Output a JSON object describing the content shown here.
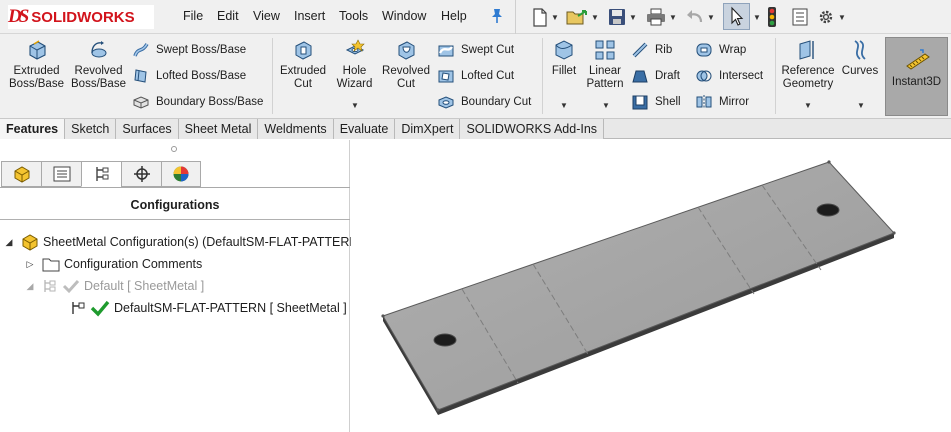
{
  "app": {
    "brand": "SOLIDWORKS",
    "brand_mark": "DS"
  },
  "menu": [
    "File",
    "Edit",
    "View",
    "Insert",
    "Tools",
    "Window",
    "Help"
  ],
  "ribbon": {
    "extruded_boss": "Extruded\nBoss/Base",
    "revolved_boss": "Revolved\nBoss/Base",
    "swept_boss": "Swept Boss/Base",
    "lofted_boss": "Lofted Boss/Base",
    "boundary_boss": "Boundary Boss/Base",
    "extruded_cut": "Extruded\nCut",
    "hole_wizard": "Hole\nWizard",
    "revolved_cut": "Revolved\nCut",
    "swept_cut": "Swept Cut",
    "lofted_cut": "Lofted Cut",
    "boundary_cut": "Boundary Cut",
    "fillet": "Fillet",
    "linear_pattern": "Linear\nPattern",
    "rib": "Rib",
    "draft": "Draft",
    "shell": "Shell",
    "wrap": "Wrap",
    "intersect": "Intersect",
    "mirror": "Mirror",
    "reference_geometry": "Reference\nGeometry",
    "curves": "Curves",
    "instant3d": "Instant3D"
  },
  "tabs": [
    "Features",
    "Sketch",
    "Surfaces",
    "Sheet Metal",
    "Weldments",
    "Evaluate",
    "DimXpert",
    "SOLIDWORKS Add-Ins"
  ],
  "panel": {
    "title": "Configurations",
    "tree": {
      "root": "SheetMetal Configuration(s)  (DefaultSM-FLAT-PATTERN",
      "comments": "Configuration Comments",
      "default": "Default [ SheetMetal ]",
      "flat": "DefaultSM-FLAT-PATTERN [ SheetMetal ]"
    }
  },
  "colors": {
    "brand_red": "#d2141c",
    "check_green": "#1f9b2e",
    "plate_gray": "#a3a3a3"
  }
}
